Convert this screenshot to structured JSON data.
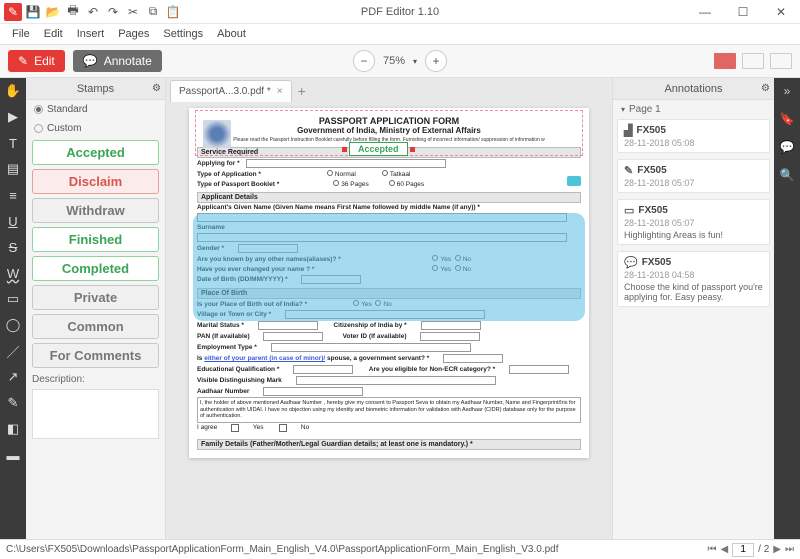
{
  "title": "PDF Editor 1.10",
  "menu": [
    "File",
    "Edit",
    "Insert",
    "Pages",
    "Settings",
    "About"
  ],
  "modebar": {
    "edit": "Edit",
    "annotate": "Annotate",
    "zoom": "75%"
  },
  "stampsPanel": {
    "title": "Stamps",
    "standard": "Standard",
    "custom": "Custom",
    "stamps": [
      "Accepted",
      "Disclaim",
      "Withdraw",
      "Finished",
      "Completed",
      "Private",
      "Common",
      "For Comments"
    ],
    "descLabel": "Description:"
  },
  "tabs": {
    "doc": "PassportA...3.0.pdf *"
  },
  "doc": {
    "title1": "PASSPORT APPLICATION FORM",
    "title2": "Government of India, Ministry of External Affairs",
    "sub": "Please read the Passport Instruction Booklet carefully before filling the form. Furnishing of incorrect information/ suppression of information w",
    "stamp": "Accepted",
    "secService": "Service Required",
    "applyingFor": "Applying for *",
    "typeApp": "Type of Application *",
    "normal": "Normal",
    "tatkaal": "Tatkaal",
    "typeBooklet": "Type of Passport Booklet *",
    "p36": "36 Pages",
    "p60": "60 Pages",
    "secApplicant": "Applicant Details",
    "givenName": "Applicant's Given Name (Given Name means First Name followed by middle Name (if any)) *",
    "surname": "Surname",
    "gender": "Gender *",
    "aliases": "Are you known by any other names(aliases)? *",
    "changed": "Have you ever changed your name ? *",
    "yes": "Yes",
    "no": "No",
    "dob": "Date of Birth (DD/MM/YYYY) *",
    "secPlace": "Place Of Birth",
    "outIndia": "Is your Place of Birth out of India? *",
    "village": "Village or Town or City *",
    "marital": "Marital Status *",
    "citizen": "Citizenship of India by *",
    "pan": "PAN (If available)",
    "voter": "Voter ID (If available)",
    "emp": "Employment Type *",
    "parent": "Is either of your parent (in case of minor)/ spouse, a government servant? *",
    "edu": "Educational Qualification *",
    "ecr": "Are you eligible for Non-ECR category? *",
    "mark": "Visible Distinguishing Mark",
    "aadhaar": "Aadhaar Number",
    "aadhaarTxt": "I, the holder of above mentioned Aadhaar Number , hereby give my consent to Passport Seva to obtain my Aadhaar Number, Name and Fingerprint/Iris for authentication with UIDAI. I have no objection using my identity and biometric information for validation with Aadhaar (CIDR) database only for the purpose of authentication.",
    "agree": "I agree",
    "secFamily": "Family Details (Father/Mother/Legal Guardian details; at least one is mandatory.) *"
  },
  "annots": {
    "title": "Annotations",
    "page": "Page 1",
    "items": [
      {
        "user": "FX505",
        "ts": "28-11-2018 05:08",
        "txt": ""
      },
      {
        "user": "FX505",
        "ts": "28-11-2018 05:07",
        "txt": ""
      },
      {
        "user": "FX505",
        "ts": "28-11-2018 05:07",
        "txt": "Highlighting Areas is fun!"
      },
      {
        "user": "FX505",
        "ts": "28-11-2018 04:58",
        "txt": "Choose the kind of passport you're applying for. Easy peasy."
      }
    ]
  },
  "status": {
    "path": "C:\\Users\\FX505\\Downloads\\PassportApplicationForm_Main_English_V4.0\\PassportApplicationForm_Main_English_V3.0.pdf",
    "page": "1",
    "total": "/ 2"
  }
}
